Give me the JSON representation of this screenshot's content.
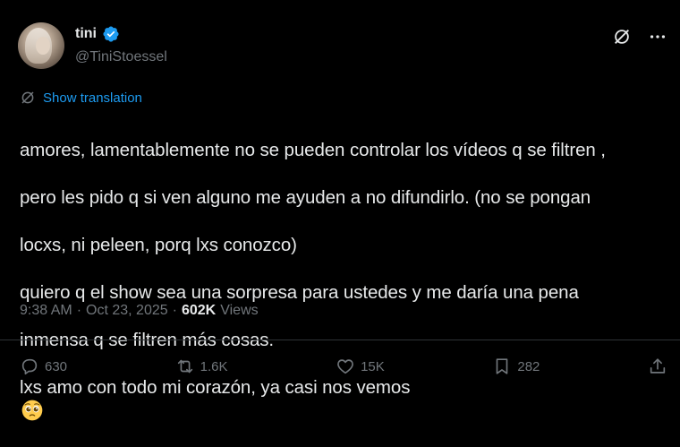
{
  "author": {
    "display_name": "tini",
    "handle": "@TiniStoessel",
    "verified": true
  },
  "translate": {
    "label": "Show translation"
  },
  "tweet": {
    "lines": [
      "amores, lamentablemente no se pueden controlar los vídeos q se filtren ,",
      "pero les pido q si ven alguno me ayuden a no difundirlo. (no se pongan",
      "locxs, ni peleen, porq lxs conozco)",
      "quiero q el show sea una sorpresa para ustedes y me daría una pena",
      "inmensa q se filtren más cosas.",
      "lxs amo con todo mi corazón, ya casi nos vemos"
    ],
    "emoji": "pleading-face-icon"
  },
  "meta": {
    "time": "9:38 AM",
    "sep1": "·",
    "date": "Oct 23, 2025",
    "sep2": "·",
    "views_count": "602K",
    "views_label": "Views"
  },
  "actions": {
    "replies": "630",
    "reposts": "1.6K",
    "likes": "15K",
    "bookmarks": "282"
  },
  "colors": {
    "background": "#000000",
    "text": "#e7e9ea",
    "secondary": "#71767b",
    "accent": "#1d9bf0"
  }
}
